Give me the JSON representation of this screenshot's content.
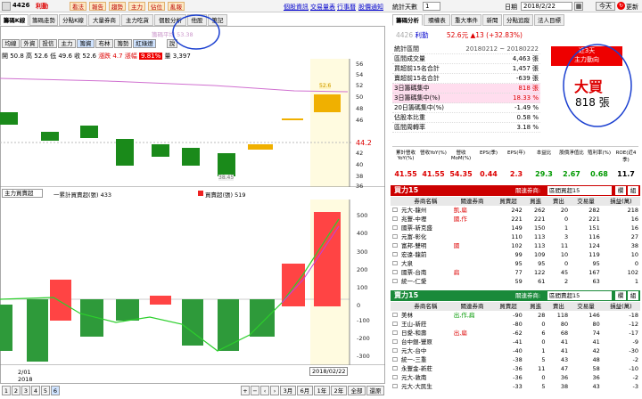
{
  "toolbar": {
    "code": "4426",
    "name": "利勤",
    "btns": [
      "看法",
      "報告",
      "趨勢",
      "主力",
      "佔位",
      "亂報"
    ],
    "links": [
      "個股資訊",
      "交易量表",
      "行事曆",
      "股價通知"
    ]
  },
  "tabs": [
    "籌碼K線",
    "籌碼走勢",
    "分點K線",
    "大量券商",
    "主力吃貨",
    "個股分析",
    "他股",
    "筆記"
  ],
  "subbtns": [
    "均線",
    "外資",
    "投信",
    "主力",
    "籌資",
    "布林",
    "籌勢",
    "紅綠燈",
    "說"
  ],
  "ohlc": {
    "open": "開 50.8",
    "high": "高 52.6",
    "low": "低 49.6",
    "close": "收 52.6",
    "chg_pct": "漲跌 4.7",
    "chg_pct2": "漲幅",
    "chg_val": "9.81%",
    "vol_lbl": "量",
    "vol": "3,397",
    "title": "籌碼平均 53.38"
  },
  "price_axis": [
    "56",
    "54",
    "52",
    "50",
    "48",
    "46",
    "44.2",
    "42",
    "40",
    "38",
    "36"
  ],
  "bar_values": [
    "52.6",
    "38.45"
  ],
  "lower": {
    "select": "主力買賣超",
    "legend1": "一累計買賣超(張) 433",
    "legend2": "買賣超(張) 519"
  },
  "lower_axis": [
    "500",
    "400",
    "300",
    "200",
    "100",
    "0",
    "-100",
    "-200",
    "-300"
  ],
  "dates": {
    "left": "2/01",
    "left2": "2018",
    "right": "2018/02/22"
  },
  "bottom_btns": [
    "1",
    "2",
    "3",
    "4",
    "5",
    "6",
    "3月",
    "6月",
    "1年",
    "2年",
    "全部",
    "還原"
  ],
  "right_top": {
    "days_lbl": "統計天數",
    "days": "1",
    "date_lbl": "日期",
    "date": "2018/2/22",
    "today": "今天",
    "refresh": "更新"
  },
  "rtabs": [
    "籌碼分析",
    "贖權表",
    "重大事件",
    "新聞",
    "分點追蹤",
    "法人目標"
  ],
  "quote": {
    "code": "4426",
    "name": "利勤",
    "price": "52.6元",
    "chg": "▲13 (+32.83%)",
    "range": "20180212 ~ 20180222"
  },
  "stats": [
    {
      "l": "統計區間",
      "v": "20180212 ~ 20180222"
    },
    {
      "l": "區間成交量",
      "v": "4,463 張"
    },
    {
      "l": "買超前15名合計",
      "v": "1,457 張"
    },
    {
      "l": "賣超前15名合計",
      "v": "-639 張"
    },
    {
      "l": "3日籌碼集中",
      "v": "818 張"
    },
    {
      "l": "3日籌碼集中(%)",
      "v": "18.33 %"
    },
    {
      "l": "20日籌碼集中(%)",
      "v": "-1.49 %"
    },
    {
      "l": "佔股本比重",
      "v": "0.58 %"
    },
    {
      "l": "區間周轉率",
      "v": "3.18 %"
    }
  ],
  "signal": {
    "days": "近3天",
    "dir": "主力動向",
    "big": "大買",
    "amt": "818 張"
  },
  "fin": {
    "heads": [
      "累計營收YoY(%)",
      "營收YoY(%)",
      "營收MoM(%)",
      "EPS(季)",
      "EPS(年)",
      "本益比",
      "股價淨值比",
      "殖利率(%)",
      "ROE(近4季)"
    ],
    "vals": [
      "41.55",
      "41.55",
      "54.35",
      "0.44",
      "2.3",
      "29.3",
      "2.67",
      "0.68",
      "11.7"
    ]
  },
  "buy": {
    "title": "買力15",
    "rel": "關連券商:",
    "sel": "區間買超15",
    "btn1": "欄",
    "btn2": "組",
    "heads": [
      "券商名稱",
      "關連券商",
      "買賣超",
      "買進",
      "賣出",
      "交易量",
      "損益(萬)"
    ],
    "rows": [
      [
        "元大-龍州",
        "凱,扁",
        "242",
        "262",
        "20",
        "282",
        "218"
      ],
      [
        "兆豐-中壢",
        "國,作",
        "221",
        "221",
        "0",
        "221",
        "16"
      ],
      [
        "國票-新克盛",
        "",
        "149",
        "150",
        "1",
        "151",
        "16"
      ],
      [
        "元富-彰化",
        "",
        "110",
        "113",
        "3",
        "116",
        "27"
      ],
      [
        "富邦-雙明",
        "國",
        "102",
        "113",
        "11",
        "124",
        "38"
      ],
      [
        "宏遠-龍前",
        "",
        "99",
        "109",
        "10",
        "119",
        "10"
      ],
      [
        "大泉",
        "",
        "95",
        "95",
        "0",
        "95",
        "0"
      ],
      [
        "國票-台南",
        "扁",
        "77",
        "122",
        "45",
        "167",
        "102"
      ],
      [
        "統一-仁愛",
        "",
        "59",
        "61",
        "2",
        "63",
        "1"
      ]
    ]
  },
  "sell": {
    "title": "賣力15",
    "rel": "關連券商:",
    "sel": "區間賣超15",
    "btn1": "欄",
    "btn2": "組",
    "heads": [
      "券商名稱",
      "關連券商",
      "買賣超",
      "買進",
      "賣出",
      "交易量",
      "損益(萬)"
    ],
    "rows": [
      [
        "美林",
        "出,作,扁",
        "-90",
        "28",
        "118",
        "146",
        "-18"
      ],
      [
        "王山-新莊",
        "",
        "-80",
        "0",
        "80",
        "80",
        "-12"
      ],
      [
        "日愛-和壽",
        "出,扁",
        "-62",
        "6",
        "68",
        "74",
        "-17"
      ],
      [
        "台中銀-豐原",
        "",
        "-41",
        "0",
        "41",
        "41",
        "-9"
      ],
      [
        "元大-台中",
        "",
        "-40",
        "1",
        "41",
        "42",
        "-30"
      ],
      [
        "統一-三重",
        "",
        "-38",
        "5",
        "43",
        "48",
        "-2"
      ],
      [
        "永豐金-新莊",
        "",
        "-36",
        "11",
        "47",
        "58",
        "-10"
      ],
      [
        "元大-敦南",
        "",
        "-36",
        "0",
        "36",
        "36",
        "-2"
      ],
      [
        "元大-大民生",
        "",
        "-33",
        "5",
        "38",
        "43",
        "-3"
      ]
    ]
  }
}
